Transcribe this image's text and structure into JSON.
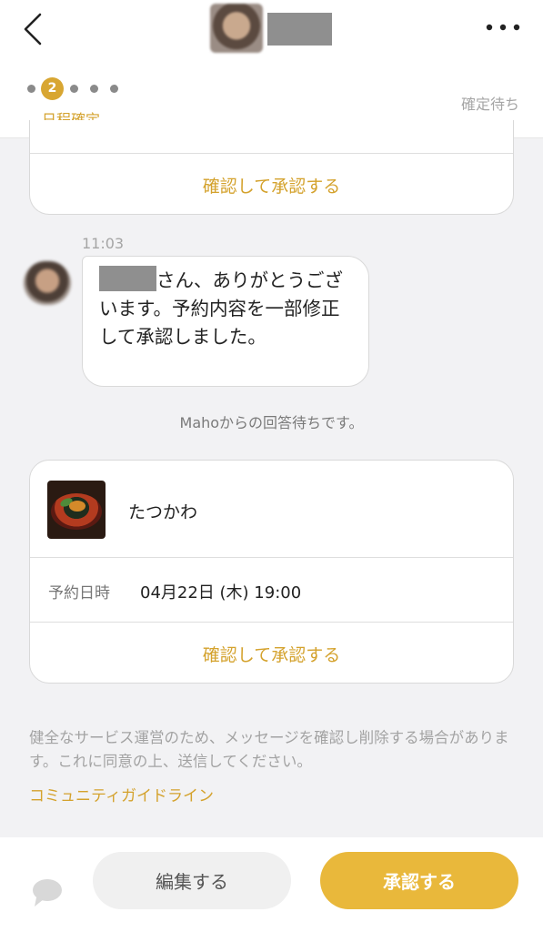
{
  "header": {
    "progress": {
      "active_step": "2",
      "step_label": "日程確定"
    },
    "status": "確定待ち"
  },
  "top_card": {
    "action_label": "確認して承認する"
  },
  "message": {
    "time": "11:03",
    "text": "さん、ありがとうございます。予約内容を一部修正して承認しました。"
  },
  "wait_note": "Mahoからの回答待ちです。",
  "reservation_card": {
    "shop_name": "たつかわ",
    "datetime_label": "予約日時",
    "datetime_value": "04月22日 (木) 19:00",
    "action_label": "確認して承認する"
  },
  "notice": {
    "text": "健全なサービス運営のため、メッセージを確認し削除する場合があります。これに同意の上、送信してください。",
    "link_label": "コミュニティガイドライン"
  },
  "footer": {
    "edit_label": "編集する",
    "approve_label": "承認する"
  },
  "colors": {
    "accent": "#d4a22d",
    "approve_button": "#e9b83b",
    "background": "#f2f2f4"
  }
}
